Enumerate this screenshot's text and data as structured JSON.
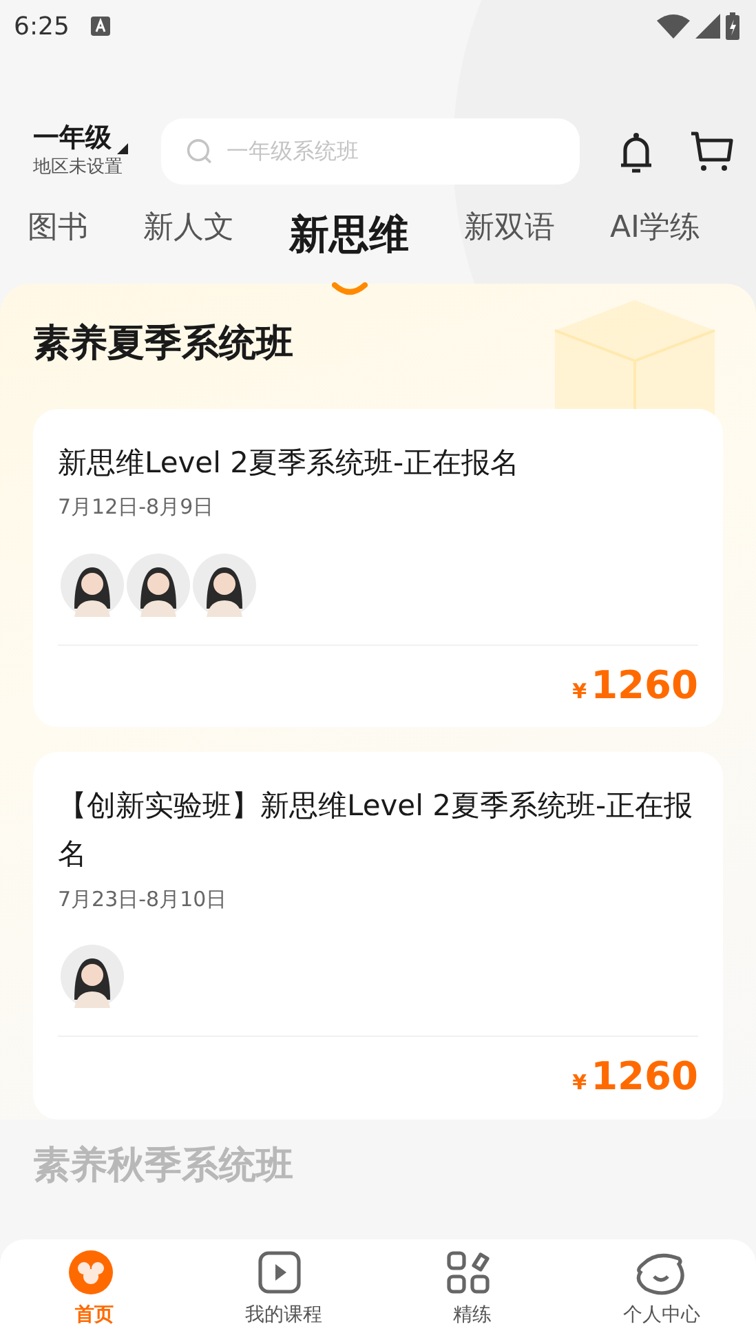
{
  "status_bar": {
    "time": "6:25"
  },
  "header": {
    "grade": "一年级",
    "region": "地区未设置",
    "search": {
      "placeholder": "一年级系统班"
    }
  },
  "tabs": [
    {
      "label": "图书",
      "selected": false
    },
    {
      "label": "新人文",
      "selected": false
    },
    {
      "label": "新思维",
      "selected": true
    },
    {
      "label": "新双语",
      "selected": false
    },
    {
      "label": "AI学练",
      "selected": false
    }
  ],
  "section": {
    "title": "素养夏季系统班",
    "courses": [
      {
        "title": "新思维Level 2夏季系统班-正在报名",
        "dates": "7月12日-8月9日",
        "currency": "¥",
        "price": "1260"
      },
      {
        "title": "【创新实验班】新思维Level 2夏季系统班-正在报名",
        "dates": "7月23日-8月10日",
        "currency": "¥",
        "price": "1260"
      }
    ]
  },
  "next_section": {
    "title": "素养秋季系统班"
  },
  "bottom_nav": [
    {
      "label": "首页",
      "selected": true
    },
    {
      "label": "我的课程",
      "selected": false
    },
    {
      "label": "精练",
      "selected": false
    },
    {
      "label": "个人中心",
      "selected": false
    }
  ]
}
